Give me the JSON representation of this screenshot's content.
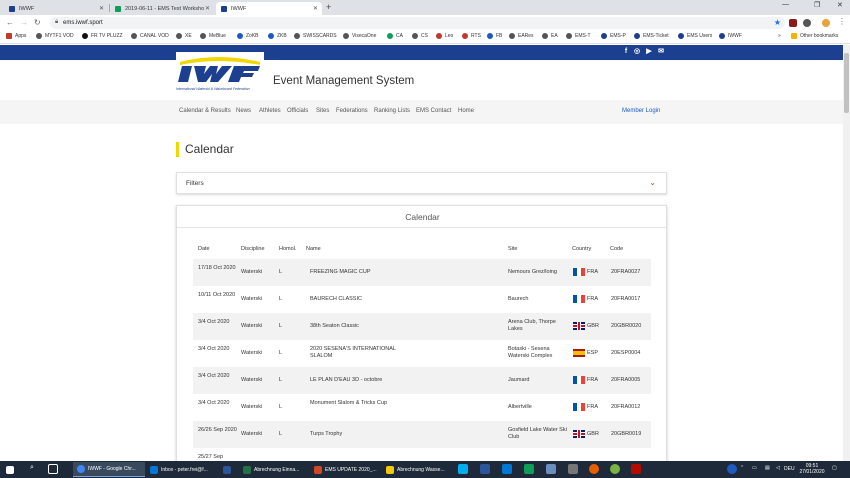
{
  "browser": {
    "tabs": [
      {
        "label": "IWWF",
        "active": false,
        "favicon_color": "#1d3f8f"
      },
      {
        "label": "2019-06-11 - EMS Test Worksho",
        "active": false,
        "favicon_color": "#0f9d58"
      },
      {
        "label": "IWWF",
        "active": true,
        "favicon_color": "#1d3f8f"
      }
    ],
    "new_tab_icon": "plus-icon",
    "url": "ems.iwwf.sport",
    "bookmarks": [
      "Apps",
      "MYTF1 VOD",
      "FR TV PLUZZ",
      "CANAL VOD",
      "XE",
      "MeBlue",
      "ZoKB",
      "ZKB",
      "SWISSCARDS",
      "VisecaOne",
      "CA",
      "CS",
      "Leo",
      "RTS",
      "FB",
      "EARes",
      "EA",
      "EMS-T",
      "EMS-P",
      "EMS-Ticket",
      "EMS Users",
      "IWWF"
    ],
    "other_bookmarks": "Other bookmarks",
    "more_bookmarks": "»"
  },
  "site": {
    "logo_text": "IWWF",
    "logo_caption": "International Waterski & Wakeboard Federation",
    "title": "Event Management System",
    "social_icons": [
      "facebook-icon",
      "instagram-icon",
      "youtube-icon",
      "mail-icon"
    ],
    "nav": [
      "Calendar & Results",
      "News",
      "Athletes",
      "Officials",
      "Sites",
      "Federations",
      "Ranking Lists",
      "EMS Contact",
      "Home"
    ],
    "member_login": "Member Login",
    "accent_color": "#1d3f8f",
    "heading_accent": "#f2d600"
  },
  "page": {
    "heading": "Calendar",
    "filters_label": "Filters",
    "card_title": "Calendar",
    "columns": [
      "Date",
      "Discipline",
      "Homol.",
      "Name",
      "Site",
      "Country",
      "Code"
    ],
    "rows": [
      {
        "date": "17/18 Oct 2020",
        "discipline": "Waterski",
        "homol": "L",
        "name": "FREEZING MAGIC CUP",
        "site": "Nemours Grez/loing",
        "flag": "fra",
        "country": "FRA",
        "code": "20FRA0027"
      },
      {
        "date": "10/11 Oct 2020",
        "discipline": "Waterski",
        "homol": "L",
        "name": "BAURECH CLASSIC",
        "site": "Baurech",
        "flag": "fra",
        "country": "FRA",
        "code": "20FRA0017"
      },
      {
        "date": "3/4 Oct 2020",
        "discipline": "Waterski",
        "homol": "L",
        "name": "38th Seaton Classic",
        "site": "Arena Club, Thorpe Lakes",
        "flag": "gbr",
        "country": "GBR",
        "code": "20GBR0020"
      },
      {
        "date": "3/4 Oct 2020",
        "discipline": "Waterski",
        "homol": "L",
        "name": "2020 SESENA'S INTERNATIONAL SLALOM",
        "site": "Botaski - Sesena Waterski Complex",
        "flag": "esp",
        "country": "ESP",
        "code": "20ESP0004"
      },
      {
        "date": "3/4 Oct 2020",
        "discipline": "Waterski",
        "homol": "L",
        "name": "LE PLAN D'EAU 3D - octobre",
        "site": "Jaumard",
        "flag": "fra",
        "country": "FRA",
        "code": "20FRA0005"
      },
      {
        "date": "3/4 Oct 2020",
        "discipline": "Waterski",
        "homol": "L",
        "name": "Monument Slalom & Tricks Cup",
        "site": "Albertville",
        "flag": "fra",
        "country": "FRA",
        "code": "20FRA0012"
      },
      {
        "date": "26/26 Sep 2020",
        "discipline": "Waterski",
        "homol": "L",
        "name": "Turps Trophy",
        "site": "Gosfield Lake Water Ski Club",
        "flag": "gbr",
        "country": "GBR",
        "code": "20GBR0019"
      },
      {
        "date": "25/27 Sep",
        "discipline": "",
        "homol": "",
        "name": "",
        "site": "",
        "flag": "",
        "country": "",
        "code": ""
      }
    ]
  },
  "taskbar": {
    "apps": [
      {
        "label": "IWWF - Google Chr...",
        "active": true,
        "color": "#4285f4"
      },
      {
        "label": "Inbox - peter.frei@f...",
        "active": false,
        "color": "#0078d4"
      },
      {
        "label": "",
        "active": false,
        "color": "#2b579a"
      },
      {
        "label": "Abrechnung Einna...",
        "active": false,
        "color": "#217346"
      },
      {
        "label": "EMS UPDATE 2020_...",
        "active": false,
        "color": "#d24726"
      },
      {
        "label": "Abrechnung Wasse...",
        "active": false,
        "color": "#f2c811"
      }
    ],
    "language": "DEU",
    "time": "09:51",
    "date": "27/01/2020"
  }
}
